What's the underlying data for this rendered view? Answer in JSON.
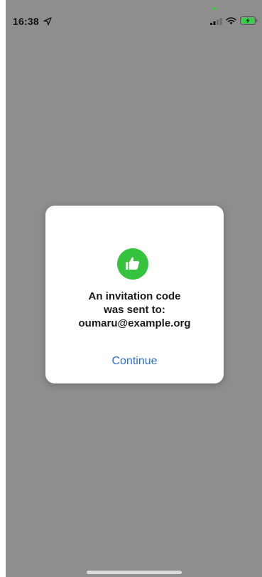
{
  "status_bar": {
    "time": "16:38",
    "icons": [
      "location-arrow-icon",
      "cellular-signal-icon",
      "wifi-icon",
      "battery-charging-icon"
    ]
  },
  "dialog": {
    "icon": "thumbs-up-icon",
    "message_lines": [
      "An invitation code",
      "was sent to:",
      "oumaru@example.org"
    ],
    "continue_label": "Continue"
  },
  "colors": {
    "backdrop": "#8e8e8e",
    "dialog_background": "#ffffff",
    "icon_green": "#35c23c",
    "link_blue": "#2a6fd6"
  }
}
